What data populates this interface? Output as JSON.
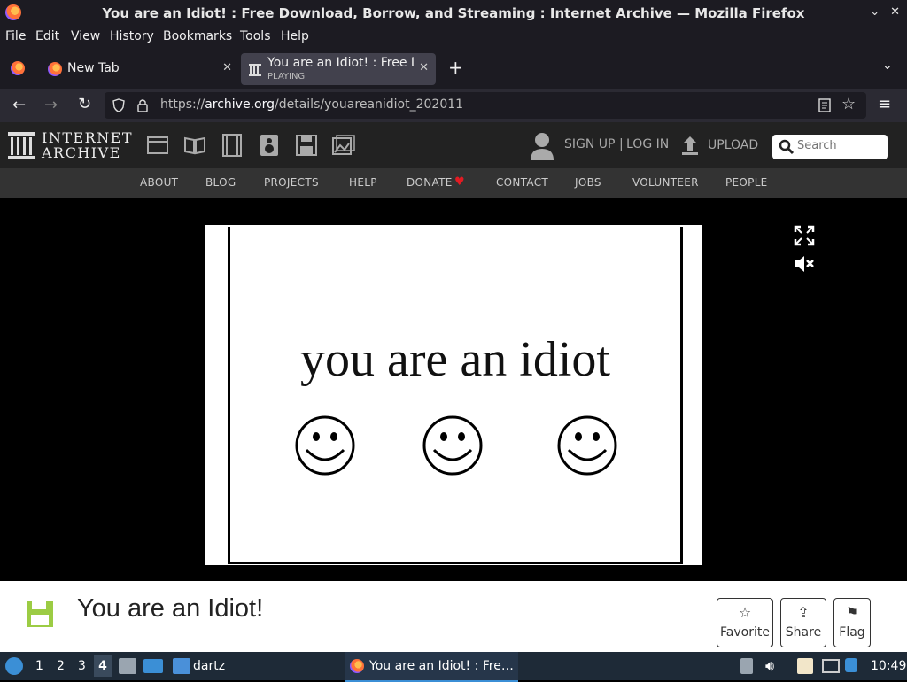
{
  "window": {
    "title": "You are an Idiot! : Free Download, Borrow, and Streaming : Internet Archive — Mozilla Firefox",
    "controls": [
      "–",
      "⌄",
      "✕"
    ]
  },
  "menubar": {
    "items": [
      {
        "label": "File",
        "key": "F"
      },
      {
        "label": "Edit",
        "key": "E"
      },
      {
        "label": "View",
        "key": "V"
      },
      {
        "label": "History",
        "key": "H"
      },
      {
        "label": "Bookmarks",
        "key": "B"
      },
      {
        "label": "Tools",
        "key": "T"
      },
      {
        "label": "Help",
        "key": "H"
      }
    ]
  },
  "tabs": [
    {
      "label": "New Tab",
      "active": false
    },
    {
      "label": "You are an Idiot! : Free D",
      "sublabel": "PLAYING",
      "active": true
    }
  ],
  "navbar": {
    "url_prefix": "https://",
    "url_host": "archive.org",
    "url_path": "/details/youareanidiot_202011"
  },
  "ia": {
    "logo_line1": "INTERNET",
    "logo_line2": "ARCHIVE",
    "signup": "SIGN UP",
    "separator": "|",
    "login": "LOG IN",
    "upload": "UPLOAD",
    "search_placeholder": "Search",
    "nav": [
      "ABOUT",
      "BLOG",
      "PROJECTS",
      "HELP",
      "DONATE",
      "CONTACT",
      "JOBS",
      "VOLUNTEER",
      "PEOPLE"
    ],
    "donate_heart_color": "#e31b23"
  },
  "video": {
    "text": "you are an idiot",
    "smileys": 3
  },
  "item": {
    "title": "You are an Idiot!",
    "actions": [
      {
        "label": "Favorite",
        "icon": "star-icon",
        "glyph": "☆"
      },
      {
        "label": "Share",
        "icon": "share-icon",
        "glyph": "⇪"
      },
      {
        "label": "Flag",
        "icon": "flag-icon",
        "glyph": "⚑"
      }
    ]
  },
  "taskbar": {
    "workspaces": [
      "1",
      "2",
      "3",
      "4"
    ],
    "active_workspace": "4",
    "folder_label": "dartz",
    "window_label": "You are an Idiot! : Fre…",
    "clock": "10:49"
  },
  "colors": {
    "ff_dark": "#1c1b22",
    "ia_top": "#222222",
    "ia_sub": "#333333",
    "disk_green": "#9ccc44",
    "taskbar": "#1e2a37"
  }
}
